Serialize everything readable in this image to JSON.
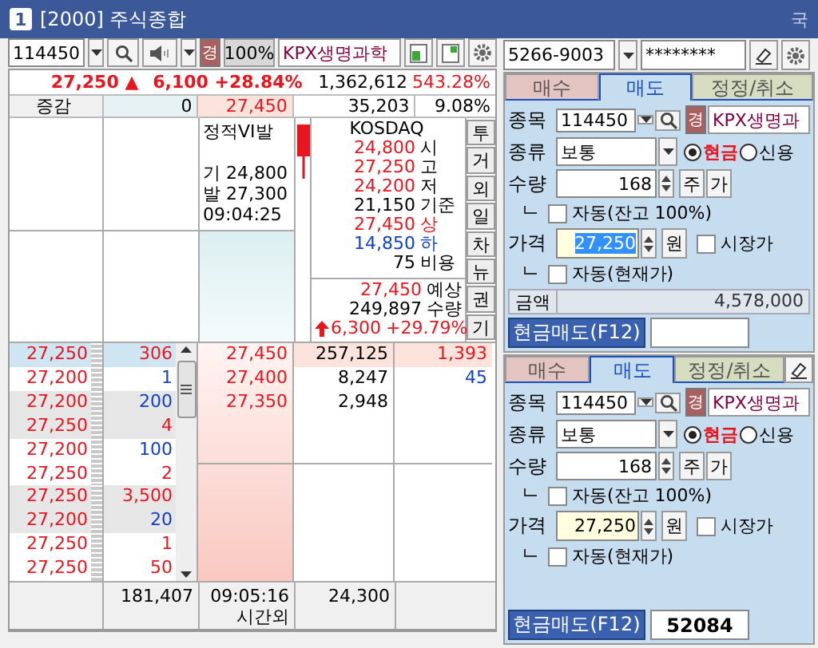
{
  "window": {
    "badge": "1",
    "title": "[2000] 주식종합",
    "right_text": "국"
  },
  "toolbar": {
    "code": "114450",
    "grade_badge": "경",
    "ratio": "100%",
    "stock_name": "KPX생명과학"
  },
  "summary": {
    "price": "27,250",
    "direction_mark": "▲",
    "change": "6,100",
    "change_rate": "+28.84%",
    "volume": "1,362,612",
    "volume_rate": "543.28%"
  },
  "summary2": {
    "label": "증감",
    "value": "0",
    "price": "27,450",
    "volume": "35,203",
    "rate": "9.08%"
  },
  "vi_info": {
    "title": "정적VI발",
    "lines": [
      "기 24,800",
      "발 27,300",
      "09:04:25"
    ]
  },
  "market_info": {
    "market": "KOSDAQ",
    "rows": [
      {
        "value": "24,800",
        "suffix": "시",
        "color": "#e8141e",
        "suffix_tinted": false
      },
      {
        "value": "27,250",
        "suffix": "고",
        "color": "#e8141e",
        "suffix_tinted": false
      },
      {
        "value": "24,200",
        "suffix": "저",
        "color": "#e8141e",
        "suffix_tinted": false
      },
      {
        "value": "21,150",
        "suffix": "기준",
        "color": "#000000",
        "suffix_tinted": false
      },
      {
        "value": "27,450",
        "suffix": "상",
        "color": "#e8141e",
        "suffix_tinted": true
      },
      {
        "value": "14,850",
        "suffix": "하",
        "color": "#1040c8",
        "suffix_tinted": true
      },
      {
        "value": "75",
        "suffix": "비용",
        "color": "#000000",
        "suffix_tinted": false
      }
    ]
  },
  "expected": {
    "price": "27,450",
    "price_label": "예상",
    "volume": "249,897",
    "volume_label": "수량",
    "change": "6,300",
    "rate": "+29.79%"
  },
  "side_tabs": [
    {
      "label": "투"
    },
    {
      "label": "거"
    },
    {
      "label": "외"
    },
    {
      "label": "일"
    },
    {
      "label": "차"
    },
    {
      "label": "뉴"
    },
    {
      "label": "권"
    },
    {
      "label": "기"
    }
  ],
  "ticks": [
    {
      "price": "27,250",
      "qty": "306",
      "color": "#e8141e",
      "highlighted": true
    },
    {
      "price": "27,200",
      "qty": "1",
      "color": "#1040c8",
      "highlighted": false
    },
    {
      "price": "27,200",
      "qty": "200",
      "color": "#1040c8",
      "highlighted": false
    },
    {
      "price": "27,250",
      "qty": "4",
      "color": "#e8141e",
      "highlighted": false
    },
    {
      "price": "27,200",
      "qty": "100",
      "color": "#1040c8",
      "highlighted": false
    },
    {
      "price": "27,250",
      "qty": "2",
      "color": "#e8141e",
      "highlighted": false
    },
    {
      "price": "27,250",
      "qty": "3,500",
      "color": "#e8141e",
      "highlighted": false
    },
    {
      "price": "27,200",
      "qty": "20",
      "color": "#1040c8",
      "highlighted": false
    },
    {
      "price": "27,250",
      "qty": "1",
      "color": "#e8141e",
      "highlighted": false
    },
    {
      "price": "27,250",
      "qty": "50",
      "color": "#e8141e",
      "highlighted": false
    }
  ],
  "bids": [
    {
      "price": "27,450",
      "volume": "257,125",
      "change": "1,393",
      "color": "#e8141e",
      "highlighted": true
    },
    {
      "price": "27,400",
      "volume": "8,247",
      "change": "45",
      "color": "#1040c8",
      "highlighted": false
    },
    {
      "price": "27,350",
      "volume": "2,948",
      "highlighted": false
    }
  ],
  "footer": {
    "total_qty": "181,407",
    "time": "09:05:16",
    "session": "시간외",
    "volume": "24,300"
  },
  "account": {
    "number": "5266-9003",
    "password": "********"
  },
  "order_forms": [
    {
      "tabs": [
        {
          "label": "매수",
          "selected": false
        },
        {
          "label": "매도",
          "selected": true
        },
        {
          "label": "정정/취소",
          "selected": false
        }
      ],
      "eraser": false,
      "code_label": "종목",
      "code": "114450",
      "badge": "경",
      "name": "KPX생명과",
      "type_label": "종류",
      "type": "보통",
      "credit_options": [
        {
          "label": "현금",
          "selected": true
        },
        {
          "label": "신용",
          "selected": false
        }
      ],
      "qty_label": "수량",
      "qty": "168",
      "qty_unit": "주",
      "qty_button": "가",
      "auto_balance": {
        "label": "자동(잔고 100%)",
        "checked": false
      },
      "price_label": "가격",
      "price": "27,250",
      "price_selected": true,
      "price_unit": "원",
      "market_price": {
        "label": "시장가",
        "checked": false
      },
      "auto_current": {
        "label": "자동(현재가)",
        "checked": false
      },
      "amount_label": "금액",
      "amount": "4,578,000",
      "submit": "현금매도(F12)"
    },
    {
      "tabs": [
        {
          "label": "매수",
          "selected": false
        },
        {
          "label": "매도",
          "selected": true
        },
        {
          "label": "정정/취소",
          "selected": false
        }
      ],
      "eraser": true,
      "code_label": "종목",
      "code": "114450",
      "badge": "경",
      "name": "KPX생명과",
      "type_label": "종류",
      "type": "보통",
      "credit_options": [
        {
          "label": "현금",
          "selected": true
        },
        {
          "label": "신용",
          "selected": false
        }
      ],
      "qty_label": "수량",
      "qty": "168",
      "qty_unit": "주",
      "qty_button": "가",
      "auto_balance": {
        "label": "자동(잔고 100%)",
        "checked": false
      },
      "price_label": "가격",
      "price": "27,250",
      "price_selected": false,
      "price_unit": "원",
      "market_price": {
        "label": "시장가",
        "checked": false
      },
      "auto_current": {
        "label": "자동(현재가)",
        "checked": false
      },
      "submit": "현금매도(F12)",
      "order_number": "52084"
    }
  ]
}
